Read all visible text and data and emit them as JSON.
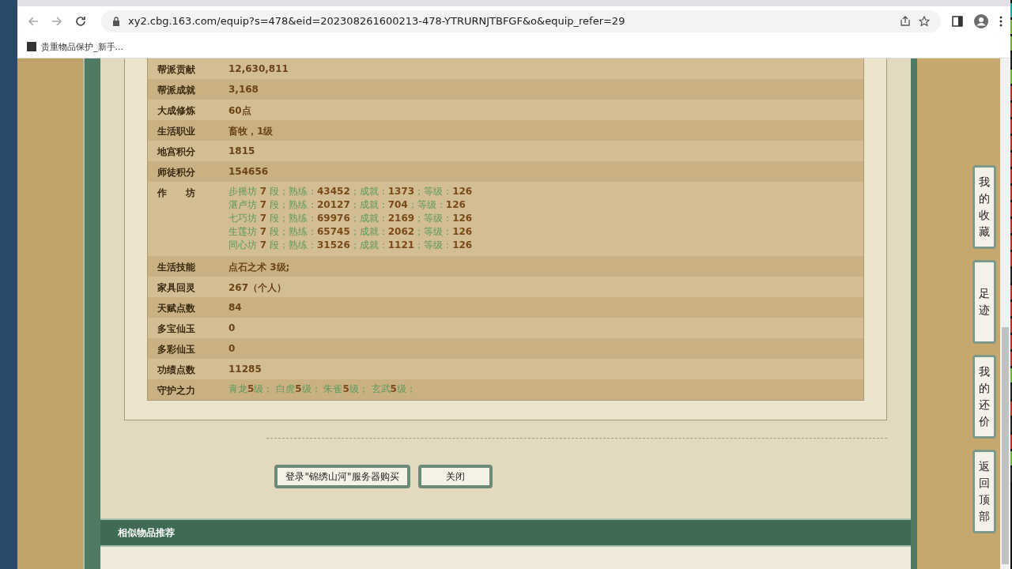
{
  "browser": {
    "url": "xy2.cbg.163.com/equip?s=478&eid=202308261600213-478-YTRURNJTBFGF&o&equip_refer=29",
    "bookmarks": [
      "贵重物品保护_新手..."
    ]
  },
  "rows": [
    {
      "kind": "plain",
      "label": "帮派贡献",
      "value": "12,630,811"
    },
    {
      "kind": "plain",
      "label": "帮派成就",
      "value": "3,168"
    },
    {
      "kind": "plain",
      "label": "大成修炼",
      "value": "60点"
    },
    {
      "kind": "plain",
      "label": "生活职业",
      "value": "畜牧，1级"
    },
    {
      "kind": "plain",
      "label": "地宫积分",
      "value": "1815"
    },
    {
      "kind": "plain",
      "label": "师徒积分",
      "value": "154656"
    },
    {
      "kind": "lines",
      "label": "作　　坊",
      "lines": [
        "步摇坊 **7** 段；熟练：**43452**；成就：**1373**；等级：**126**",
        "湛卢坊 **7** 段；熟练：**20127**；成就：**704**；等级：**126**",
        "七巧坊 **7** 段；熟练：**69976**；成就：**2169**；等级：**126**",
        "生莲坊 **7** 段；熟练：**65745**；成就：**2062**；等级：**126**",
        "同心坊 **7** 段；熟练：**31526**；成就：**1121**；等级：**126**"
      ]
    },
    {
      "kind": "plain",
      "label": "生活技能",
      "value": "点石之术 3级;"
    },
    {
      "kind": "plain",
      "label": "家具回灵",
      "value": "267（个人）"
    },
    {
      "kind": "plain",
      "label": "天赋点数",
      "value": "84"
    },
    {
      "kind": "plain",
      "label": "多宝仙玉",
      "value": "0"
    },
    {
      "kind": "plain",
      "label": "多彩仙玉",
      "value": "0"
    },
    {
      "kind": "plain",
      "label": "功绩点数",
      "value": "11285"
    },
    {
      "kind": "lines",
      "label": "守护之力",
      "lines": [
        "青龙**5**级；  白虎**5**级；  朱雀**5**级；  玄武**5**级；"
      ]
    }
  ],
  "buttons": [
    "登录\"锦绣山河\"服务器购买",
    "关闭"
  ],
  "similar_header": "相似物品推荐",
  "side_buttons": [
    "我的收藏",
    "足迹",
    "我的还价",
    "返回顶部"
  ]
}
